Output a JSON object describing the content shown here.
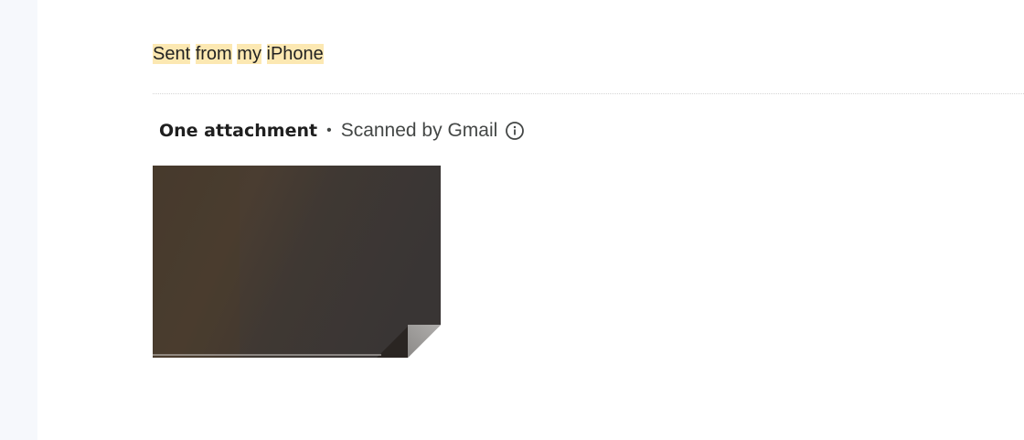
{
  "signature": {
    "words": [
      "Sent",
      "from",
      "my",
      "iPhone"
    ]
  },
  "attachments": {
    "title": "One attachment",
    "separator": "•",
    "scan_note": "Scanned by Gmail",
    "info_icon": "info-icon",
    "thumbnail_icon": "image-thumbnail"
  },
  "colors": {
    "highlight": "#fce8b2",
    "rail": "#f6f8fc",
    "thumb_dark": "#3b3530",
    "fold": "#9e9e9e"
  }
}
